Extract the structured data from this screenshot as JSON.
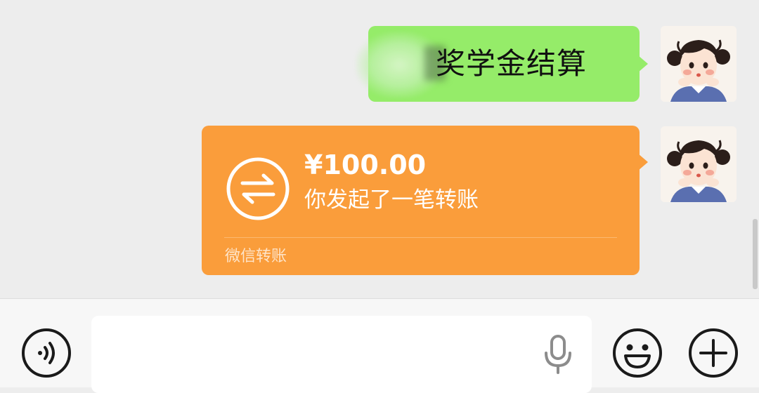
{
  "messages": {
    "text_message": {
      "text": "奖学金结算",
      "bubble_color": "#95ec69"
    },
    "transfer_message": {
      "amount": "¥100.00",
      "description": "你发起了一笔转账",
      "brand": "微信转账",
      "bubble_color": "#fa9d3b",
      "icon": "transfer-arrows-icon"
    }
  },
  "input_bar": {
    "input_value": "",
    "icons": {
      "voice": "voice-icon",
      "mic": "mic-icon",
      "emoji": "emoji-icon",
      "plus": "plus-icon"
    }
  },
  "colors": {
    "chat_background": "#ededed",
    "input_bar_background": "#f7f7f7"
  }
}
